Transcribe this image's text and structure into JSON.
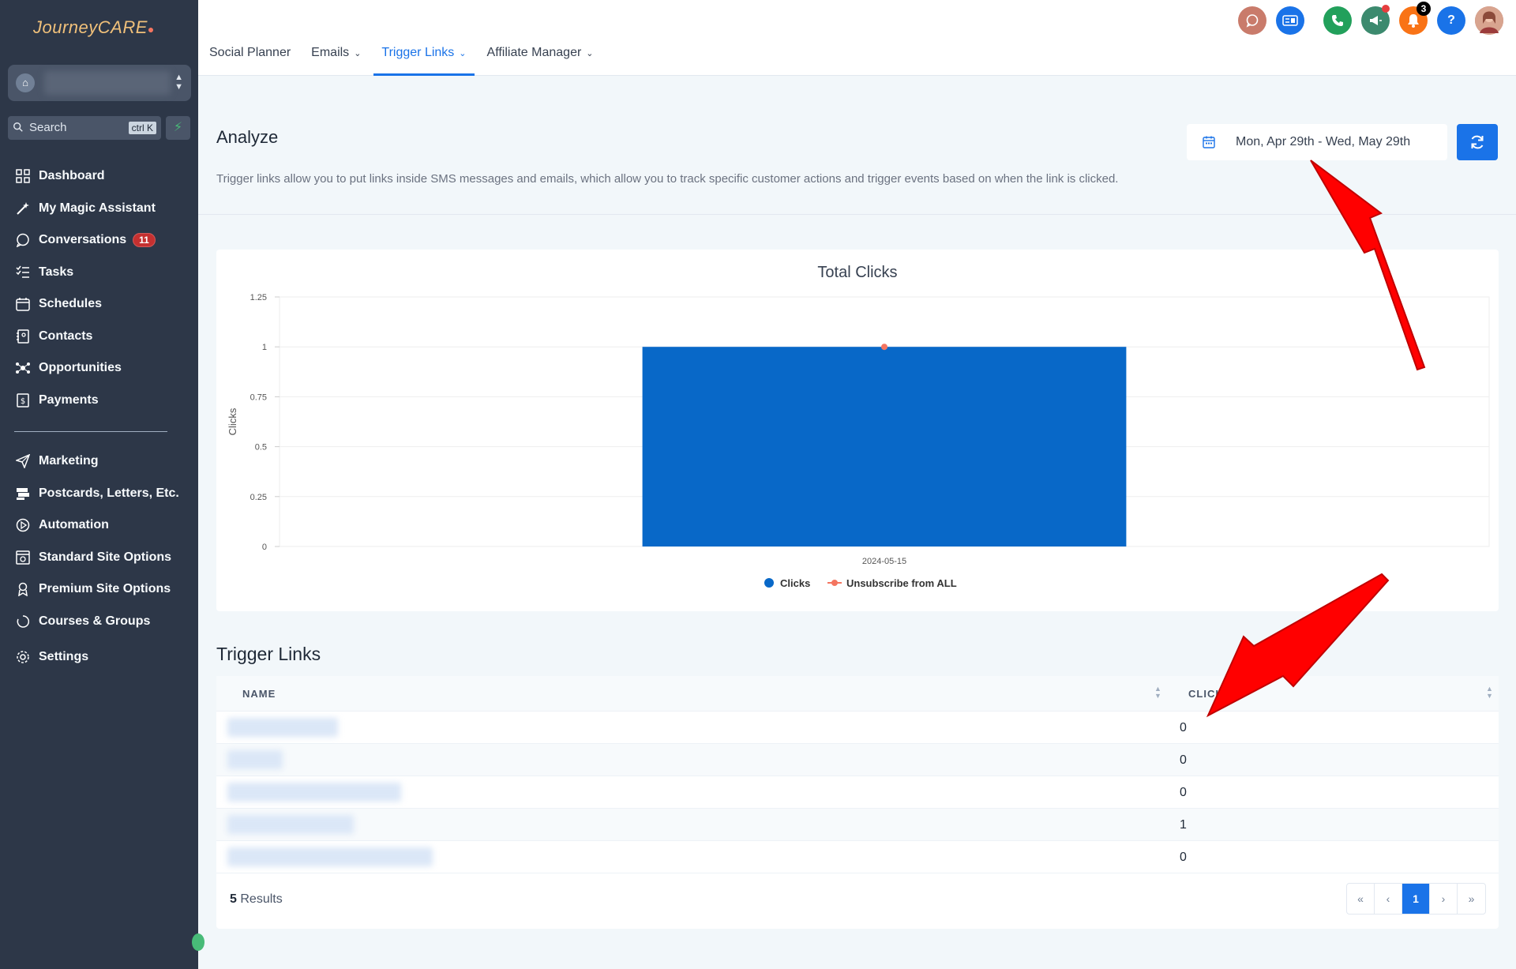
{
  "sidebar": {
    "logo": "JourneyCARE",
    "search_placeholder": "Search",
    "search_shortcut": "ctrl K",
    "items": [
      {
        "label": "Dashboard",
        "icon": "dashboard-icon"
      },
      {
        "label": "My Magic Assistant",
        "icon": "magic-wand-icon"
      },
      {
        "label": "Conversations",
        "icon": "chat-icon",
        "badge": "11"
      },
      {
        "label": "Tasks",
        "icon": "tasks-icon"
      },
      {
        "label": "Schedules",
        "icon": "calendar-icon"
      },
      {
        "label": "Contacts",
        "icon": "contacts-icon"
      },
      {
        "label": "Opportunities",
        "icon": "opportunities-icon"
      },
      {
        "label": "Payments",
        "icon": "payments-icon"
      },
      {
        "label": "Marketing",
        "icon": "send-icon"
      },
      {
        "label": "Postcards, Letters, Etc.",
        "icon": "mail-icon"
      },
      {
        "label": "Automation",
        "icon": "automation-icon"
      },
      {
        "label": "Standard Site Options",
        "icon": "site-icon"
      },
      {
        "label": "Premium Site Options",
        "icon": "premium-icon"
      },
      {
        "label": "Courses & Groups",
        "icon": "courses-icon"
      },
      {
        "label": "Settings",
        "icon": "gear-icon"
      }
    ]
  },
  "topbar": {
    "tabs": [
      {
        "label": "Social Planner"
      },
      {
        "label": "Emails"
      },
      {
        "label": "Trigger Links"
      },
      {
        "label": "Affiliate Manager"
      }
    ],
    "notification_count": "3"
  },
  "analyze": {
    "title": "Analyze",
    "description": "Trigger links allow you to put links inside SMS messages and emails, which allow you to track specific customer actions and trigger events based on when the link is clicked.",
    "date_range": "Mon, Apr 29th - Wed, May 29th"
  },
  "chart_data": {
    "type": "bar",
    "title": "Total Clicks",
    "categories": [
      "2024-05-15"
    ],
    "series": [
      {
        "name": "Clicks",
        "type": "bar",
        "values": [
          1
        ],
        "color": "#0868c8"
      },
      {
        "name": "Unsubscribe from ALL",
        "type": "line",
        "values": [
          1
        ],
        "color": "#f47560"
      }
    ],
    "ylabel": "Clicks",
    "xlabel": "",
    "ylim": [
      0,
      1.25
    ],
    "yticks": [
      "0",
      "0.25",
      "0.5",
      "0.75",
      "1",
      "1.25"
    ],
    "grid": true,
    "legend": "bottom-center"
  },
  "table": {
    "title": "Trigger Links",
    "columns": [
      "NAME",
      "CLICKS"
    ],
    "rows": [
      {
        "clicks": "0"
      },
      {
        "clicks": "0"
      },
      {
        "clicks": "0"
      },
      {
        "clicks": "1"
      },
      {
        "clicks": "0"
      }
    ],
    "results_count": "5",
    "results_label": "Results",
    "pagination": [
      "«",
      "‹",
      "1",
      "›",
      "»"
    ]
  },
  "colors": {
    "accent": "#1a73e8",
    "sidebar": "#2d3748",
    "annotation_arrow": "#ff0000"
  }
}
